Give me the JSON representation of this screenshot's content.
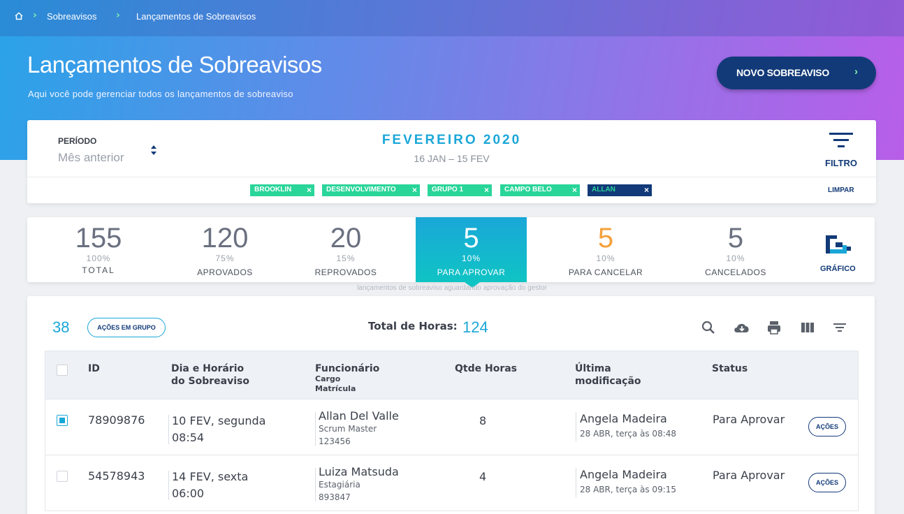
{
  "breadcrumb": {
    "items": [
      "Sobreavisos",
      "Lançamentos de Sobreavisos"
    ]
  },
  "header": {
    "title": "Lançamentos de Sobreavisos",
    "subtitle": "Aqui você pode gerenciar todos os lançamentos de sobreaviso",
    "new_button": "NOVO SOBREAVISO"
  },
  "period": {
    "label": "PERÍODO",
    "value": "Mês anterior",
    "month": "FEVEREIRO 2020",
    "range": "16 JAN – 15 FEV",
    "filter_label": "FILTRO",
    "chips": [
      "BROOKLIN",
      "DESENVOLVIMENTO",
      "GRUPO 1",
      "CAMPO BELO",
      "ALLAN"
    ],
    "clear_label": "LIMPAR"
  },
  "stats": [
    {
      "num": "155",
      "pct": "100%",
      "label": "TOTAL"
    },
    {
      "num": "120",
      "pct": "75%",
      "label": "APROVADOS"
    },
    {
      "num": "20",
      "pct": "15%",
      "label": "REPROVADOS"
    },
    {
      "num": "5",
      "pct": "10%",
      "label": "PARA APROVAR"
    },
    {
      "num": "5",
      "pct": "10%",
      "label": "PARA CANCELAR"
    },
    {
      "num": "5",
      "pct": "10%",
      "label": "CANCELADOS"
    }
  ],
  "chart_label": "GRÁFICO",
  "hint": "lançamentos de sobreaviso aguardando aprovação do gestor",
  "table": {
    "count": "38",
    "group_actions": "AÇÕES EM GRUPO",
    "total_label": "Total de Horas:",
    "total_value": "124",
    "headers": {
      "id": "ID",
      "date_1": "Dia e Horário",
      "date_2": "do Sobreaviso",
      "employee": "Funcionário",
      "employee_sub1": "Cargo",
      "employee_sub2": "Matrícula",
      "hours": "Qtde Horas",
      "modified_1": "Última",
      "modified_2": "modificação",
      "status": "Status"
    },
    "rows": [
      {
        "id": "78909876",
        "day": "10 FEV, segunda",
        "time": "08:54",
        "name": "Allan Del Valle",
        "role": "Scrum Master",
        "reg": "123456",
        "hours": "8",
        "mod_name": "Angela Madeira",
        "mod_date": "28 ABR, terça às 08:48",
        "status": "Para Aprovar",
        "action": "AÇÕES"
      },
      {
        "id": "54578943",
        "day": "14 FEV, sexta",
        "time": "06:00",
        "name": "Luiza Matsuda",
        "role": "Estagiária",
        "reg": "893847",
        "hours": "4",
        "mod_name": "Angela Madeira",
        "mod_date": "28 ABR, terça às 09:15",
        "status": "Para Aprovar",
        "action": "AÇÕES"
      }
    ]
  },
  "colors": {
    "accent": "#1aa7d8",
    "navy": "#123a78",
    "green": "#2ad59a",
    "orange": "#f5a03a"
  }
}
